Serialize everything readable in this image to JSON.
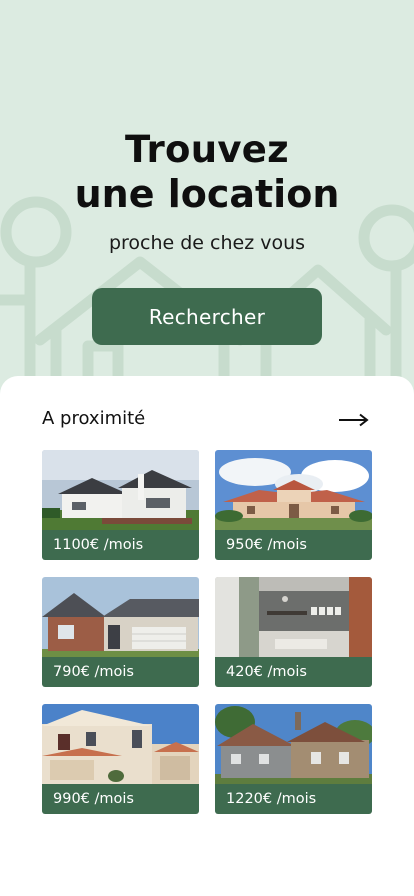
{
  "hero": {
    "title_line1": "Trouvez",
    "title_line2": "une location",
    "subtitle": "proche de chez vous",
    "search_label": "Rechercher"
  },
  "nearby": {
    "title": "A proximité",
    "see_all_icon": "arrow-right-icon",
    "listings": [
      {
        "price": "1100€ /mois",
        "photo": "modern-white-house-photo"
      },
      {
        "price": "950€ /mois",
        "photo": "mediterranean-villa-photo"
      },
      {
        "price": "790€ /mois",
        "photo": "brick-suburban-house-photo"
      },
      {
        "price": "420€ /mois",
        "photo": "apartment-interior-photo"
      },
      {
        "price": "990€ /mois",
        "photo": "stucco-house-photo"
      },
      {
        "price": "1220€ /mois",
        "photo": "stone-cottage-photo"
      }
    ]
  },
  "colors": {
    "background": "#dcebe1",
    "accent": "#3e6b4f",
    "card_surface": "#ffffff"
  }
}
